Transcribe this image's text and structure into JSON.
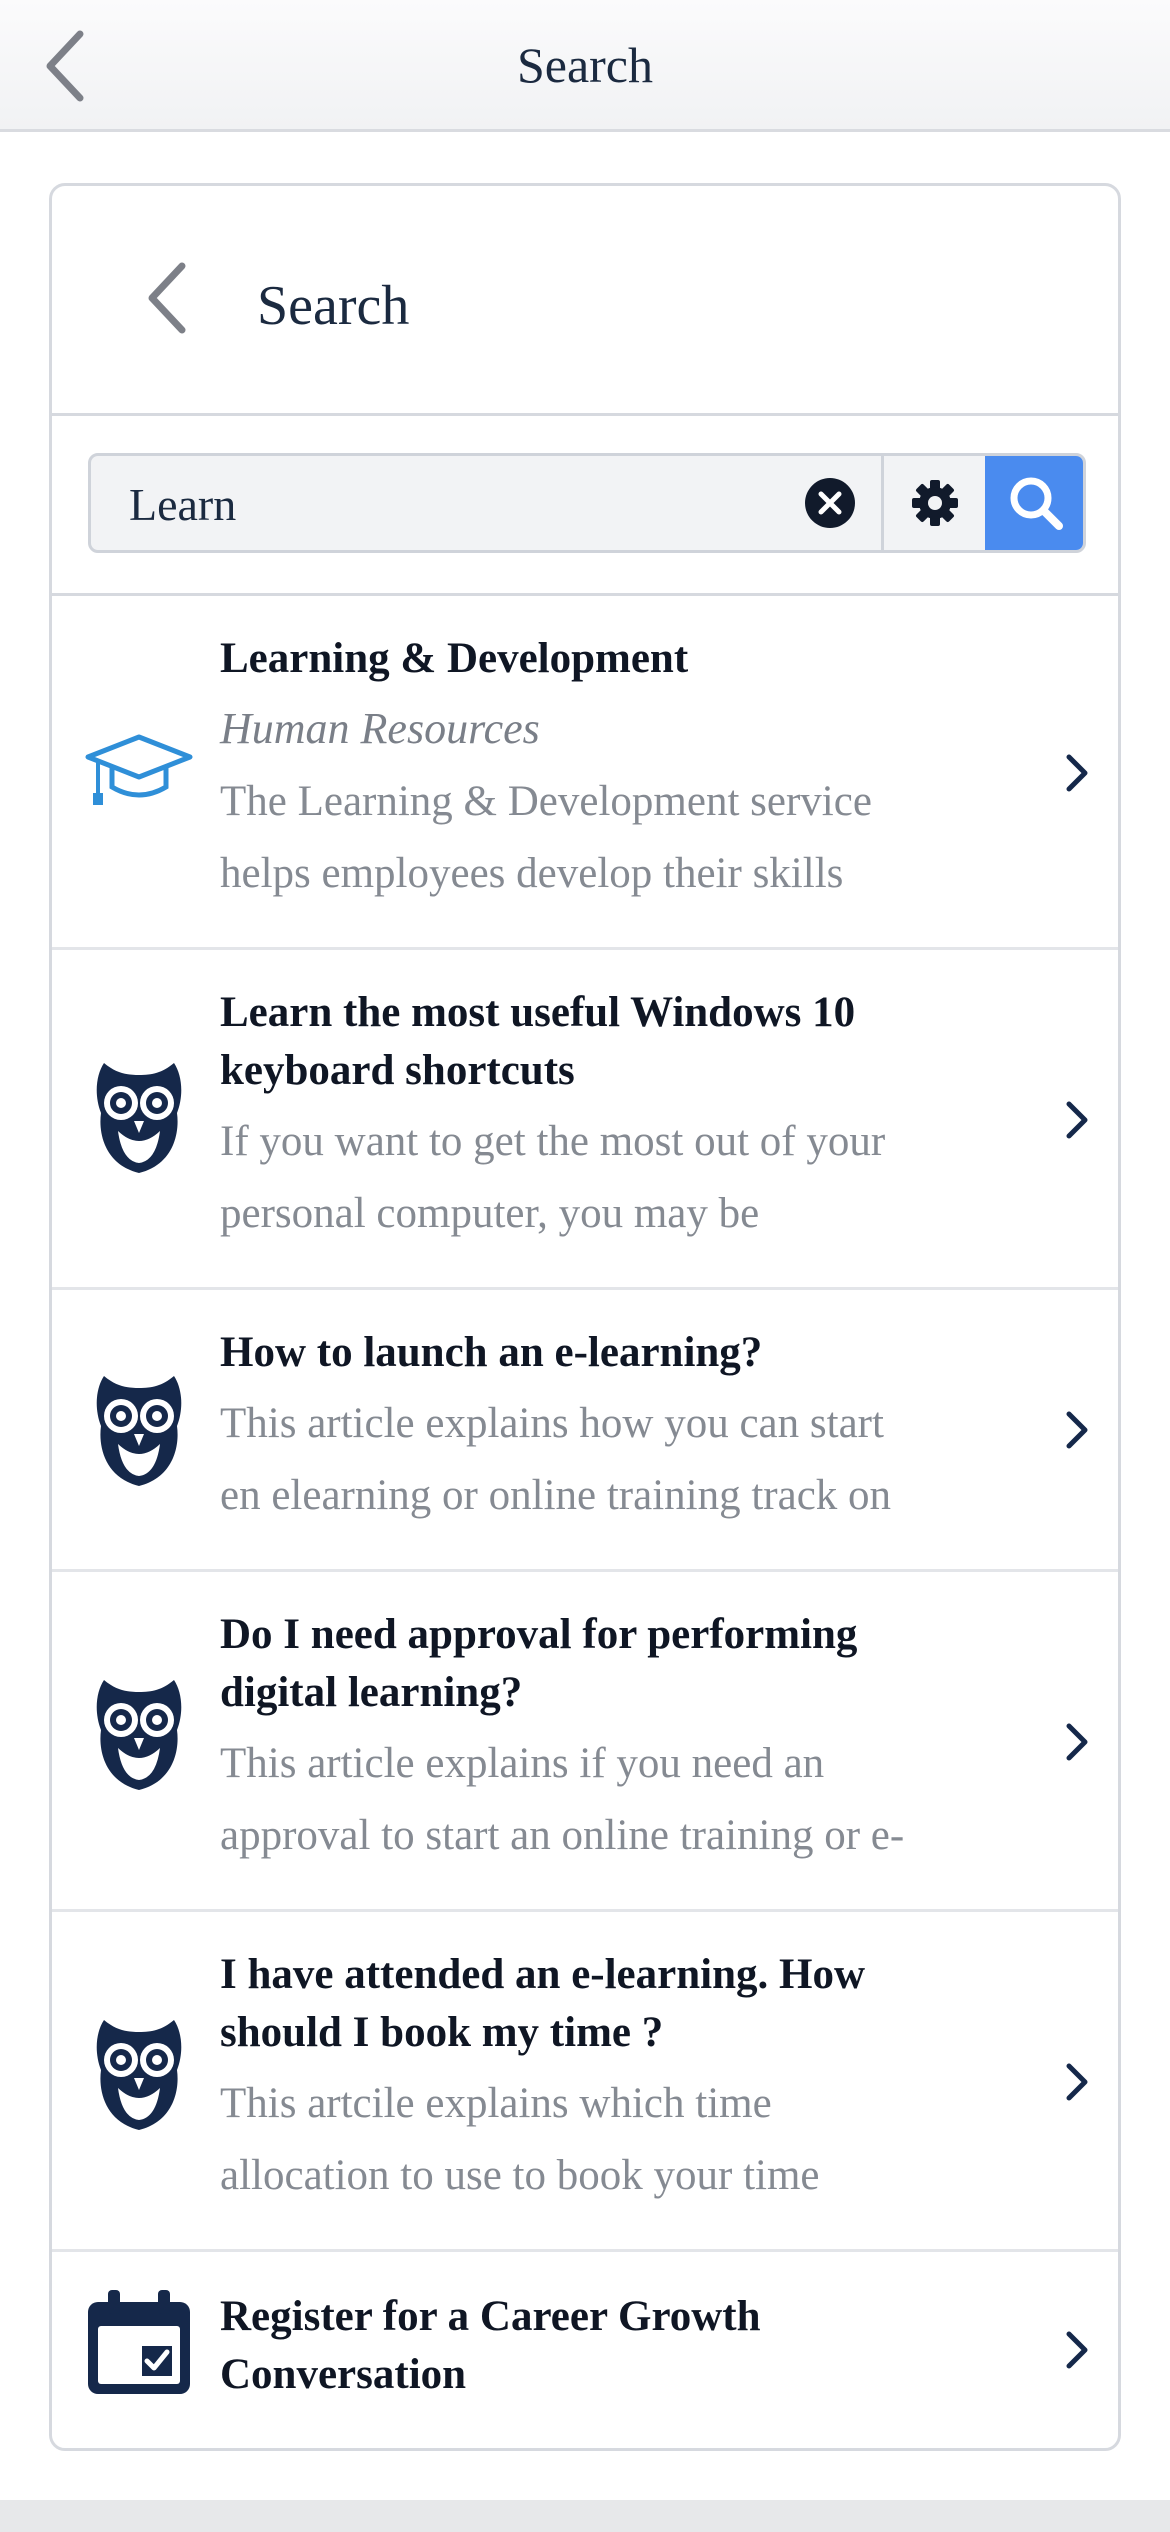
{
  "header": {
    "title": "Search"
  },
  "card": {
    "title": "Search"
  },
  "search": {
    "value": "Learn",
    "placeholder": ""
  },
  "results": [
    {
      "icon": "graduation-cap-icon",
      "title": "Learning & Development",
      "subtitle": "Human Resources",
      "description_lines": [
        "The Learning & Development service",
        "helps employees develop their skills"
      ]
    },
    {
      "icon": "owl-icon",
      "title_lines": [
        "Learn the most useful Windows 10",
        "keyboard shortcuts"
      ],
      "description_lines": [
        "If you want to get the most out of your",
        "personal computer, you may be"
      ]
    },
    {
      "icon": "owl-icon",
      "title_lines": [
        "How to launch an e-learning?"
      ],
      "description_lines": [
        "This article explains how you can start",
        "en elearning or online training track on"
      ]
    },
    {
      "icon": "owl-icon",
      "title_lines": [
        "Do I need approval for performing",
        "digital learning?"
      ],
      "description_lines": [
        "This article explains if you need an",
        "approval to start an online training or e-"
      ]
    },
    {
      "icon": "owl-icon",
      "title_lines": [
        "I have attended an e-learning. How",
        "should I book my time ?"
      ],
      "description_lines": [
        "This artcile explains which time",
        "allocation to use to book your time"
      ]
    },
    {
      "icon": "calendar-check-icon",
      "title_lines": [
        "Register for a Career Growth",
        "Conversation"
      ]
    }
  ],
  "colors": {
    "accent": "#4a8bef",
    "navy": "#15284a",
    "cap": "#2f8fd8"
  }
}
